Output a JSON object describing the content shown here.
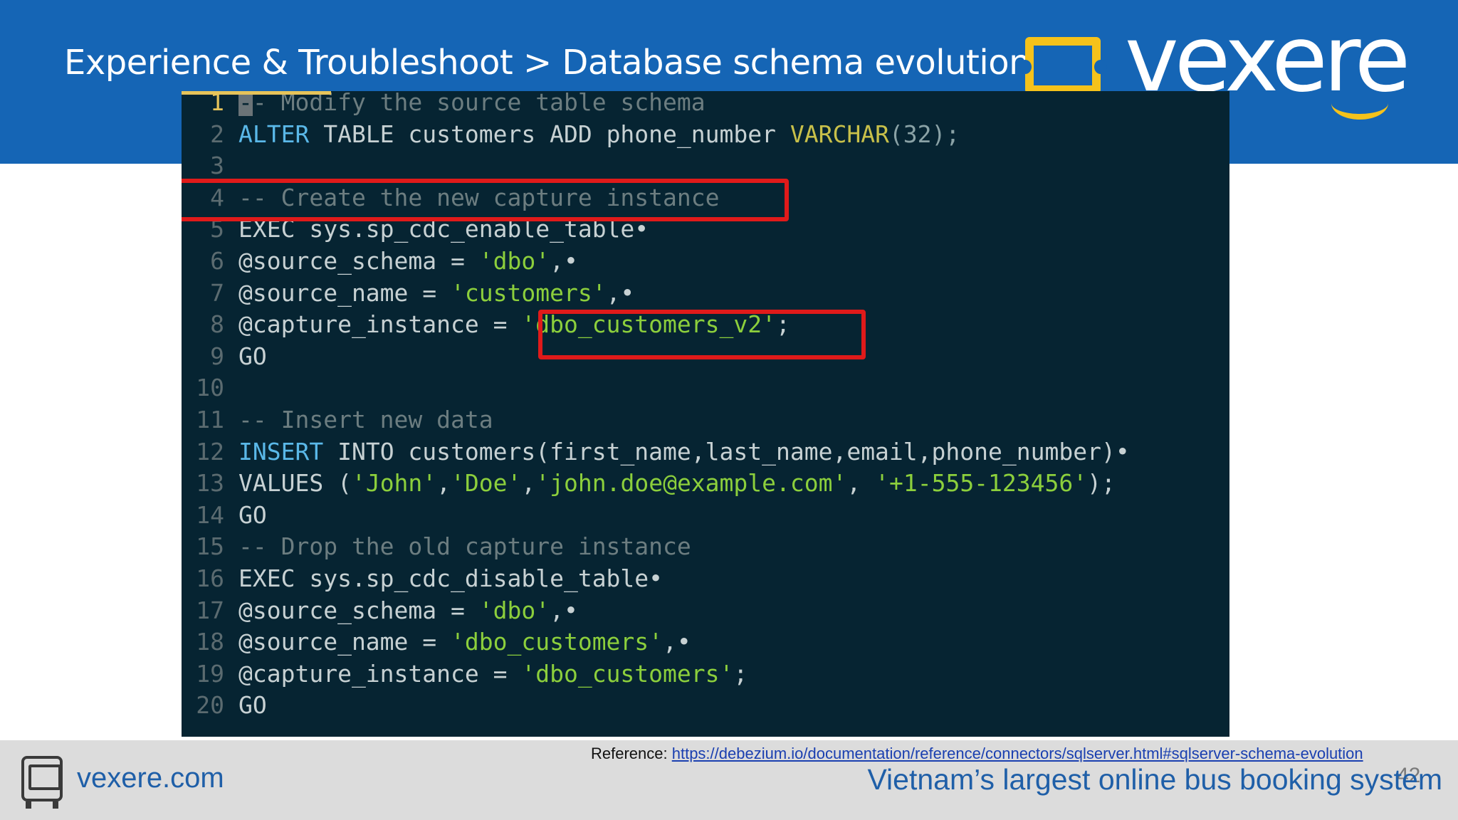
{
  "header": {
    "title": "Experience & Troubleshoot > Database schema evolution",
    "logo_text": "vexere"
  },
  "code": {
    "lines": [
      {
        "n": "1",
        "current": true,
        "tokens": [
          {
            "t": "-",
            "c": "cursor"
          },
          {
            "t": "- Modify the source table schema",
            "c": "c-cm"
          }
        ]
      },
      {
        "n": "2",
        "tokens": [
          {
            "t": "ALTER",
            "c": "c-kw"
          },
          {
            "t": " TABLE customers ADD phone_number ",
            "c": "c-tx"
          },
          {
            "t": "VARCHAR",
            "c": "c-ty"
          },
          {
            "t": "(32);",
            "c": "c-nm"
          }
        ]
      },
      {
        "n": "3",
        "tokens": []
      },
      {
        "n": "4",
        "tokens": [
          {
            "t": "-- Create the new capture instance",
            "c": "c-cm"
          }
        ]
      },
      {
        "n": "5",
        "tokens": [
          {
            "t": "EXEC sys.sp_cdc_enable_table",
            "c": "c-tx"
          },
          {
            "t": "•",
            "c": "c-dot"
          }
        ]
      },
      {
        "n": "6",
        "tokens": [
          {
            "t": "@source_schema = ",
            "c": "c-tx"
          },
          {
            "t": "'dbo'",
            "c": "c-st"
          },
          {
            "t": ",•",
            "c": "c-dot"
          }
        ]
      },
      {
        "n": "7",
        "tokens": [
          {
            "t": "@source_name = ",
            "c": "c-tx"
          },
          {
            "t": "'customers'",
            "c": "c-st"
          },
          {
            "t": ",•",
            "c": "c-dot"
          }
        ]
      },
      {
        "n": "8",
        "tokens": [
          {
            "t": "@capture_instance = ",
            "c": "c-tx"
          },
          {
            "t": "'dbo_customers_v2'",
            "c": "c-st"
          },
          {
            "t": ";",
            "c": "c-tx"
          }
        ]
      },
      {
        "n": "9",
        "tokens": [
          {
            "t": "GO",
            "c": "c-tx"
          }
        ]
      },
      {
        "n": "10",
        "tokens": []
      },
      {
        "n": "11",
        "tokens": [
          {
            "t": "-- Insert new data",
            "c": "c-cm"
          }
        ]
      },
      {
        "n": "12",
        "tokens": [
          {
            "t": "INSERT",
            "c": "c-kw"
          },
          {
            "t": " INTO customers(first_name,last_name,email,phone_number)",
            "c": "c-tx"
          },
          {
            "t": "•",
            "c": "c-dot"
          }
        ]
      },
      {
        "n": "13",
        "tokens": [
          {
            "t": "VALUES (",
            "c": "c-tx"
          },
          {
            "t": "'John'",
            "c": "c-st"
          },
          {
            "t": ",",
            "c": "c-tx"
          },
          {
            "t": "'Doe'",
            "c": "c-st"
          },
          {
            "t": ",",
            "c": "c-tx"
          },
          {
            "t": "'john.doe@example.com'",
            "c": "c-st"
          },
          {
            "t": ", ",
            "c": "c-tx"
          },
          {
            "t": "'+1-555-123456'",
            "c": "c-st"
          },
          {
            "t": ");",
            "c": "c-tx"
          }
        ]
      },
      {
        "n": "14",
        "tokens": [
          {
            "t": "GO",
            "c": "c-tx"
          }
        ]
      },
      {
        "n": "15",
        "tokens": [
          {
            "t": "-- Drop the old capture instance",
            "c": "c-cm"
          }
        ]
      },
      {
        "n": "16",
        "tokens": [
          {
            "t": "EXEC sys.sp_cdc_disable_table",
            "c": "c-tx"
          },
          {
            "t": "•",
            "c": "c-dot"
          }
        ]
      },
      {
        "n": "17",
        "tokens": [
          {
            "t": "@source_schema = ",
            "c": "c-tx"
          },
          {
            "t": "'dbo'",
            "c": "c-st"
          },
          {
            "t": ",•",
            "c": "c-dot"
          }
        ]
      },
      {
        "n": "18",
        "tokens": [
          {
            "t": "@source_name = ",
            "c": "c-tx"
          },
          {
            "t": "'dbo_customers'",
            "c": "c-st"
          },
          {
            "t": ",•",
            "c": "c-dot"
          }
        ]
      },
      {
        "n": "19",
        "tokens": [
          {
            "t": "@capture_instance = ",
            "c": "c-tx"
          },
          {
            "t": "'dbo_customers'",
            "c": "c-st"
          },
          {
            "t": ";",
            "c": "c-tx"
          }
        ]
      },
      {
        "n": "20",
        "tokens": [
          {
            "t": "GO",
            "c": "c-tx"
          }
        ]
      }
    ]
  },
  "footer": {
    "site": "vexere.com",
    "reference_label": "Reference: ",
    "reference_link": "https://debezium.io/documentation/reference/connectors/sqlserver.html#sqlserver-schema-evolution",
    "tagline": "Vietnam’s largest online bus booking system",
    "page_number": "42"
  },
  "colors": {
    "header_bg": "#1565b5",
    "accent_yellow": "#f5c21b",
    "editor_bg": "#062432",
    "highlight_red": "#e01a1a"
  },
  "icons": [
    "ticket-logo-icon",
    "bus-icon"
  ]
}
